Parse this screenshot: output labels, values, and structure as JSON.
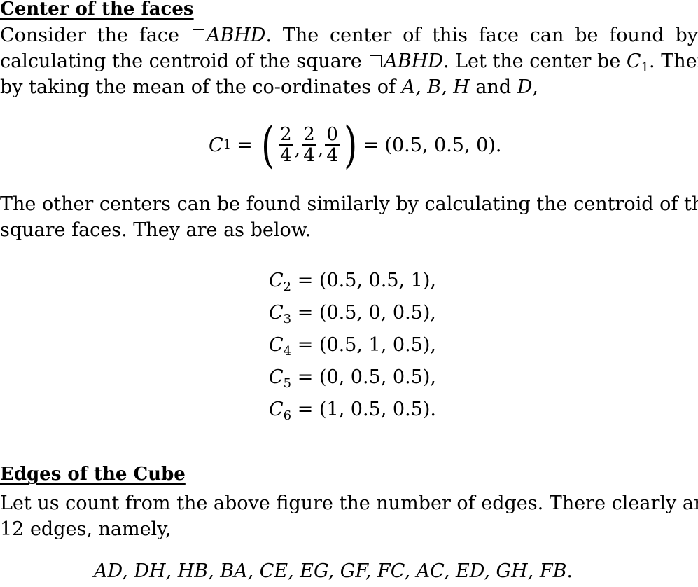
{
  "section1": {
    "heading": "Center of the faces",
    "line1_pre": "Consider the face",
    "face": "ABHD",
    "line1_post": ". The center of this face can be found by",
    "line2_pre": "calculating the centroid of the square",
    "line2_face": "ABHD",
    "line2_mid": ". Let the center be",
    "line2_var": "C",
    "line2_sub": "1",
    "line2_post": ". Then",
    "line3_pre": "by taking the mean of the co-ordinates of",
    "line3_vars": "A, B, H",
    "line3_and": "and",
    "line3_last": "D",
    "line3_post": ",",
    "eq1": {
      "lhs_var": "C",
      "lhs_sub": "1",
      "equals": "=",
      "fractions": [
        {
          "num": "2",
          "den": "4"
        },
        {
          "num": "2",
          "den": "4"
        },
        {
          "num": "0",
          "den": "4"
        }
      ],
      "rhs": "= (0.5, 0.5, 0)."
    },
    "line4": "The other centers can be found similarly by calculating the centroid of the",
    "line5": "square faces. They are as below.",
    "centers": [
      {
        "var": "C",
        "sub": "2",
        "value": "= (0.5, 0.5, 1),"
      },
      {
        "var": "C",
        "sub": "3",
        "value": "= (0.5, 0, 0.5),"
      },
      {
        "var": "C",
        "sub": "4",
        "value": "= (0.5, 1, 0.5),"
      },
      {
        "var": "C",
        "sub": "5",
        "value": "= (0, 0.5, 0.5),"
      },
      {
        "var": "C",
        "sub": "6",
        "value": "= (1, 0.5, 0.5)."
      }
    ]
  },
  "section2": {
    "heading": "Edges of the Cube",
    "line1": "Let us count from the above figure the number of edges. There clearly are",
    "line2": "12 edges, namely,",
    "edges": "AD, DH, HB, BA, CE, EG, GF, FC, AC, ED, GH, FB",
    "edges_end": "."
  }
}
